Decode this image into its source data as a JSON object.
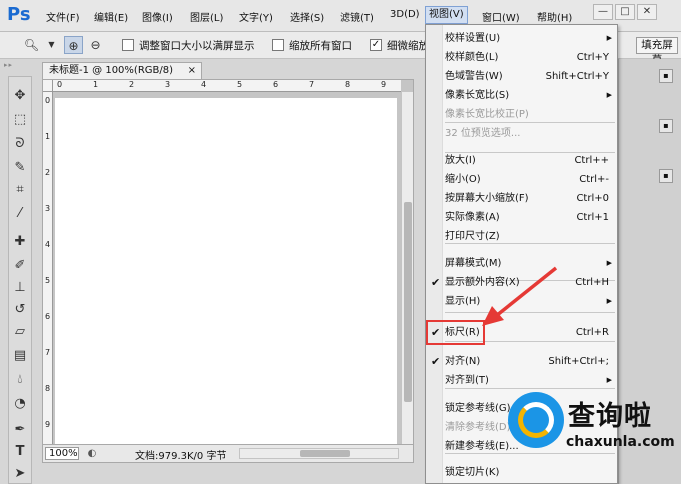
{
  "app": {
    "logo": "Ps"
  },
  "menubar": {
    "items": [
      "文件(F)",
      "编辑(E)",
      "图像(I)",
      "图层(L)",
      "文字(Y)",
      "选择(S)",
      "滤镜(T)",
      "3D(D)",
      "视图(V)",
      "窗口(W)",
      "帮助(H)"
    ],
    "window_controls": [
      "—",
      "□",
      "✕"
    ]
  },
  "options_bar": {
    "tool_icon": "zoom-icon",
    "zoom_in_icon": "zoom-in-icon",
    "zoom_out_icon": "zoom-out-icon",
    "resize_windows_label": "调整窗口大小以满屏显示",
    "resize_windows_checked": false,
    "zoom_all_label": "缩放所有窗口",
    "zoom_all_checked": false,
    "scrubby_label": "细微缩放",
    "scrubby_checked": true,
    "fill_screen_label": "填充屏幕"
  },
  "tools": [
    "move",
    "marquee",
    "lasso",
    "quick-select",
    "crop",
    "eyedropper",
    "healing",
    "brush",
    "clone-stamp",
    "history-brush",
    "eraser",
    "gradient",
    "blur",
    "dodge",
    "pen",
    "type",
    "path-select"
  ],
  "document": {
    "tab_title": "未标题-1 @ 100%(RGB/8)",
    "close": "×",
    "zoom": "100%",
    "info": "文档:979.3K/0 字节",
    "ruler_h_labels": [
      "0",
      "1",
      "2",
      "3",
      "4",
      "5",
      "6",
      "7",
      "8",
      "9"
    ],
    "ruler_v_labels": [
      "0",
      "1",
      "2",
      "3",
      "4",
      "5",
      "6",
      "7",
      "8",
      "9"
    ]
  },
  "view_menu": {
    "items": [
      {
        "label": "校样设置(U)",
        "shortcut": "",
        "submenu": true,
        "disabled": false,
        "checked": false
      },
      {
        "label": "校样颜色(L)",
        "shortcut": "Ctrl+Y",
        "submenu": false,
        "disabled": false,
        "checked": false
      },
      {
        "label": "色域警告(W)",
        "shortcut": "Shift+Ctrl+Y",
        "submenu": false,
        "disabled": false,
        "checked": false
      },
      {
        "label": "像素长宽比(S)",
        "shortcut": "",
        "submenu": true,
        "disabled": false,
        "checked": false
      },
      {
        "label": "像素长宽比校正(P)",
        "shortcut": "",
        "submenu": false,
        "disabled": true,
        "checked": false
      },
      {
        "label": "32 位预览选项...",
        "shortcut": "",
        "submenu": false,
        "disabled": true,
        "checked": false
      },
      {
        "label": "放大(I)",
        "shortcut": "Ctrl++",
        "submenu": false,
        "disabled": false,
        "checked": false
      },
      {
        "label": "缩小(O)",
        "shortcut": "Ctrl+-",
        "submenu": false,
        "disabled": false,
        "checked": false
      },
      {
        "label": "按屏幕大小缩放(F)",
        "shortcut": "Ctrl+0",
        "submenu": false,
        "disabled": false,
        "checked": false
      },
      {
        "label": "实际像素(A)",
        "shortcut": "Ctrl+1",
        "submenu": false,
        "disabled": false,
        "checked": false
      },
      {
        "label": "打印尺寸(Z)",
        "shortcut": "",
        "submenu": false,
        "disabled": false,
        "checked": false
      },
      {
        "label": "屏幕模式(M)",
        "shortcut": "",
        "submenu": true,
        "disabled": false,
        "checked": false
      },
      {
        "label": "显示额外内容(X)",
        "shortcut": "Ctrl+H",
        "submenu": false,
        "disabled": false,
        "checked": true
      },
      {
        "label": "显示(H)",
        "shortcut": "",
        "submenu": true,
        "disabled": false,
        "checked": false
      },
      {
        "label": "标尺(R)",
        "shortcut": "Ctrl+R",
        "submenu": false,
        "disabled": false,
        "checked": true
      },
      {
        "label": "对齐(N)",
        "shortcut": "Shift+Ctrl+;",
        "submenu": false,
        "disabled": false,
        "checked": true
      },
      {
        "label": "对齐到(T)",
        "shortcut": "",
        "submenu": true,
        "disabled": false,
        "checked": false
      },
      {
        "label": "锁定参考线(G)",
        "shortcut": "",
        "submenu": false,
        "disabled": false,
        "checked": false
      },
      {
        "label": "清除参考线(D)",
        "shortcut": "",
        "submenu": false,
        "disabled": true,
        "checked": false
      },
      {
        "label": "新建参考线(E)...",
        "shortcut": "",
        "submenu": false,
        "disabled": false,
        "checked": false
      },
      {
        "label": "锁定切片(K)",
        "shortcut": "",
        "submenu": false,
        "disabled": false,
        "checked": false
      }
    ]
  },
  "annotation": {
    "highlight_color": "#e53935",
    "arrow_color": "#e53935"
  },
  "watermark": {
    "title": "查询啦",
    "url": "chaxunla.com"
  }
}
